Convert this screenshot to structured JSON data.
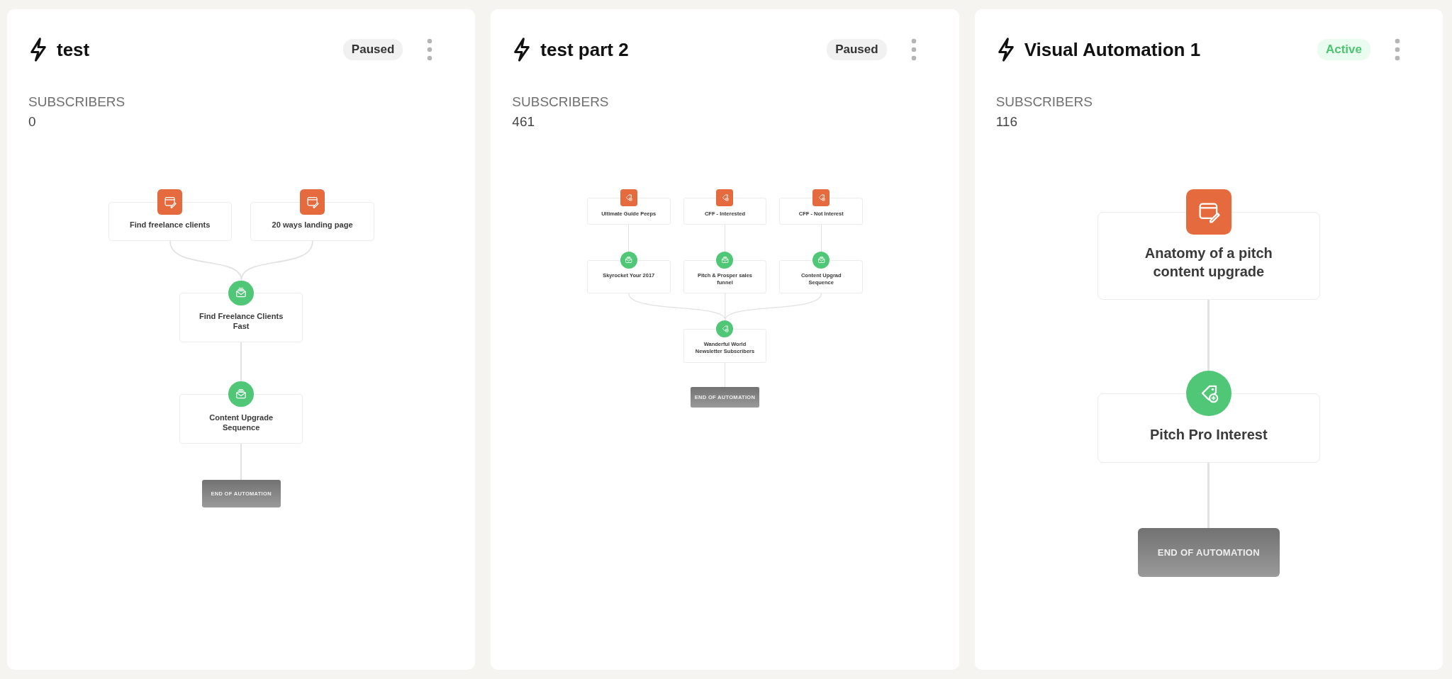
{
  "automations": [
    {
      "title": "test",
      "status": {
        "label": "Paused",
        "kind": "paused"
      },
      "subscribers_label": "SUBSCRIBERS",
      "subscribers": "0",
      "flow": {
        "tiers": [
          [
            {
              "kind": "form",
              "label": "Find freelance clients"
            },
            {
              "kind": "form",
              "label": "20 ways landing page"
            }
          ],
          [
            {
              "kind": "sequence",
              "label": "Find Freelance Clients Fast"
            }
          ],
          [
            {
              "kind": "sequence",
              "label": "Content Upgrade Sequence"
            }
          ]
        ],
        "end": "END OF AUTOMATION"
      }
    },
    {
      "title": "test part 2",
      "status": {
        "label": "Paused",
        "kind": "paused"
      },
      "subscribers_label": "SUBSCRIBERS",
      "subscribers": "461",
      "flow": {
        "tiers": [
          [
            {
              "kind": "tag_trigger",
              "label": "Ultimate Guide Peeps"
            },
            {
              "kind": "tag_trigger",
              "label": "CFF - Interested"
            },
            {
              "kind": "tag_trigger",
              "label": "CFF - Not Interest"
            }
          ],
          [
            {
              "kind": "sequence",
              "label": "Skyrocket Your 2017"
            },
            {
              "kind": "sequence",
              "label": "Pitch & Prosper sales funnel"
            },
            {
              "kind": "sequence",
              "label": "Content Upgrad\nSequence"
            }
          ],
          [
            {
              "kind": "tag",
              "label": "Wanderful World Newsletter Subscribers"
            }
          ]
        ],
        "end": "END OF AUTOMATION"
      }
    },
    {
      "title": "Visual Automation 1",
      "status": {
        "label": "Active",
        "kind": "active"
      },
      "subscribers_label": "SUBSCRIBERS",
      "subscribers": "116",
      "flow": {
        "tiers": [
          [
            {
              "kind": "form",
              "label": "Anatomy of a pitch content upgrade"
            }
          ],
          [
            {
              "kind": "tag",
              "label": "Pitch Pro Interest"
            }
          ]
        ],
        "end": "END OF AUTOMATION"
      }
    }
  ]
}
